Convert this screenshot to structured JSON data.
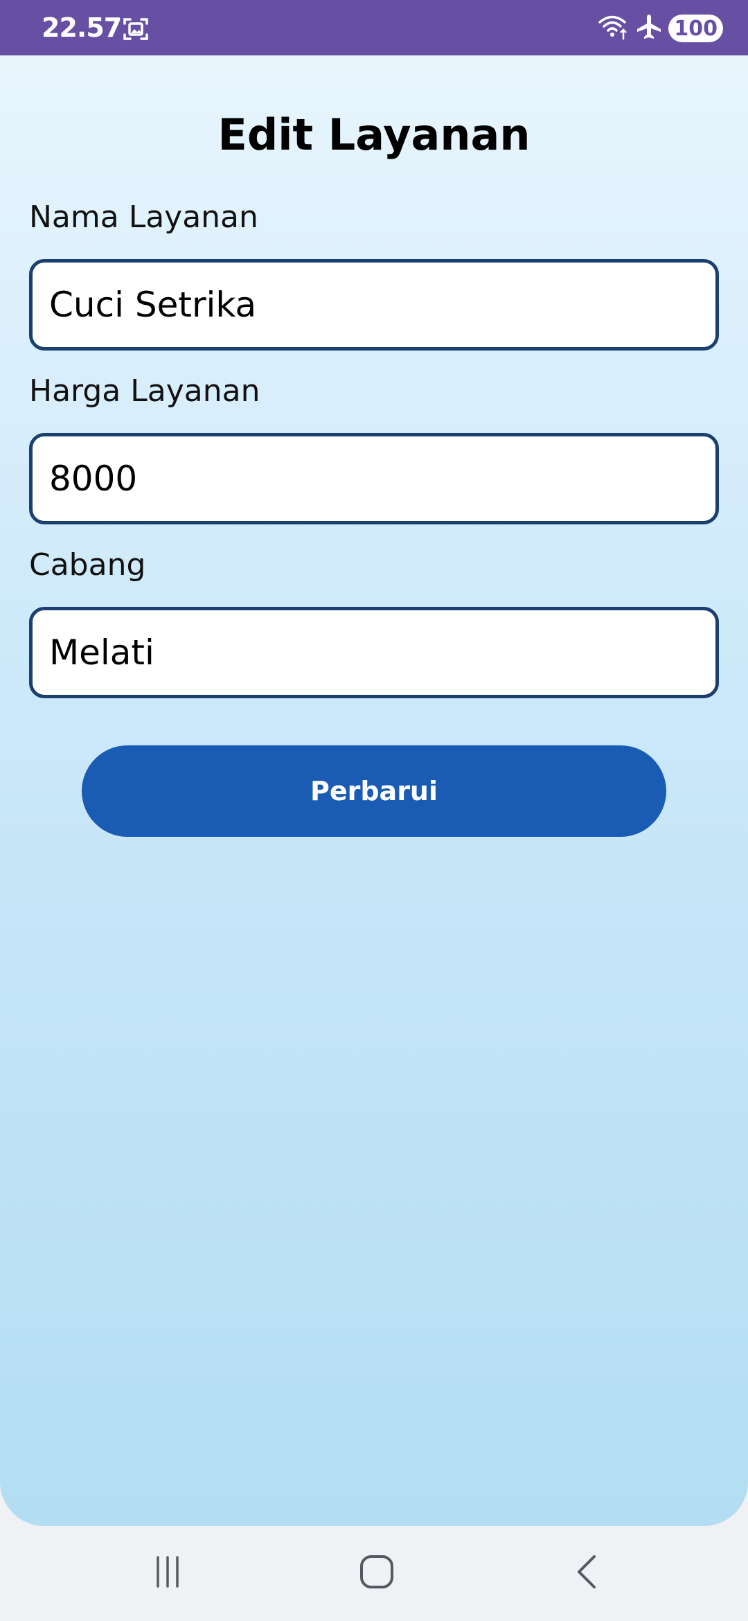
{
  "status_bar": {
    "time": "22.57",
    "battery": "100",
    "icons": [
      "screenshot-icon",
      "wifi-icon",
      "airplane-icon"
    ]
  },
  "colors": {
    "status_bar": "#6750a4",
    "accent": "#1a5cb4",
    "field_border": "#1b3f6e"
  },
  "page": {
    "title": "Edit Layanan"
  },
  "form": {
    "name": {
      "label": "Nama Layanan",
      "value": "Cuci Setrika"
    },
    "price": {
      "label": "Harga Layanan",
      "value": "8000"
    },
    "branch": {
      "label": "Cabang",
      "value": "Melati"
    },
    "submit_label": "Perbarui"
  },
  "nav": {
    "icons": [
      "recent-apps-icon",
      "home-icon",
      "back-icon"
    ]
  }
}
